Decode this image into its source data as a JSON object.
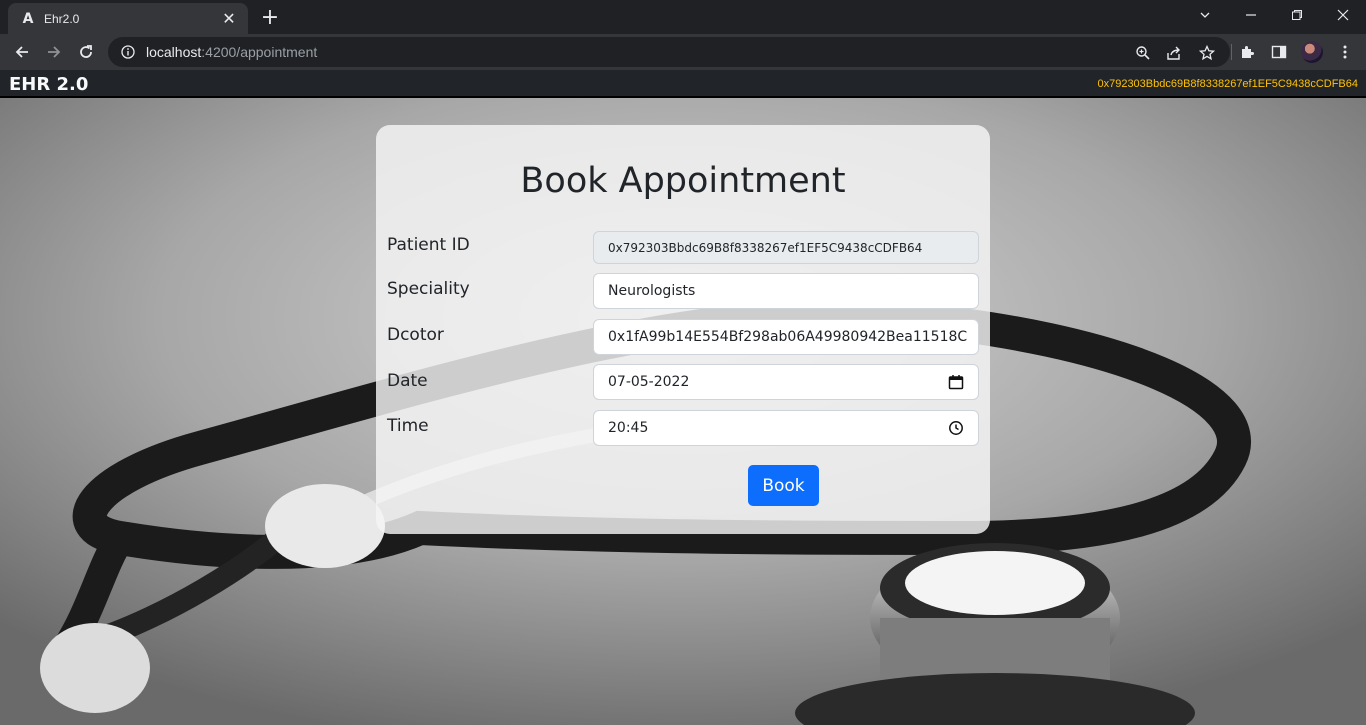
{
  "browser": {
    "tab_title": "Ehr2.0",
    "tab_favicon": "A",
    "url_host": "localhost",
    "url_path": ":4200/appointment"
  },
  "app": {
    "brand": "EHR 2.0",
    "account_address": "0x792303Bbdc69B8f8338267ef1EF5C9438cCDFB64",
    "account_color": "#ffc107"
  },
  "form": {
    "title": "Book Appointment",
    "fields": [
      {
        "label": "Patient ID",
        "value": "0x792303Bbdc69B8f8338267ef1EF5C9438cCDFB64"
      },
      {
        "label": "Speciality",
        "value": "Neurologists"
      },
      {
        "label": "Dcotor",
        "value": "0x1fA99b14E554Bf298ab06A49980942Bea11518C"
      },
      {
        "label": "Date",
        "value": "07-05-2022"
      },
      {
        "label": "Time",
        "value": "20:45"
      }
    ],
    "submit_label": "Book",
    "submit_color": "#0d6efd"
  },
  "icons": {
    "back": "back-arrow-icon",
    "forward": "forward-arrow-icon",
    "reload": "reload-icon",
    "site_info": "info-icon",
    "zoom": "zoom-icon",
    "share": "share-icon",
    "bookmark": "star-icon",
    "extensions": "puzzle-icon",
    "side_panel": "side-panel-icon",
    "calendar": "calendar-icon",
    "clock": "clock-icon"
  }
}
